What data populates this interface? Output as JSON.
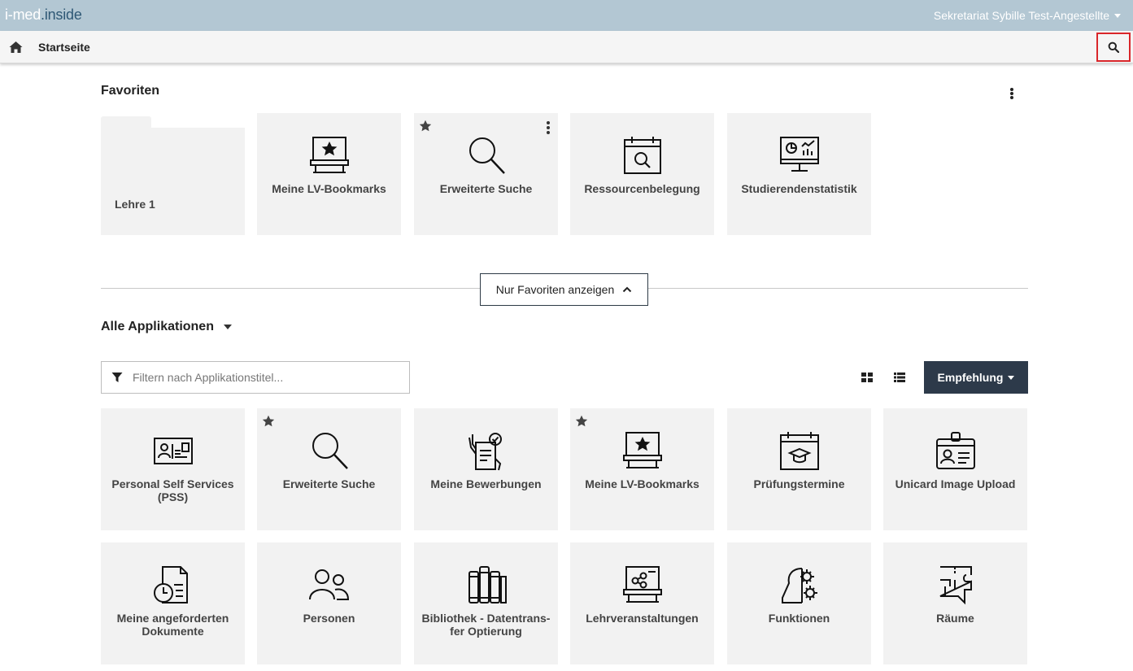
{
  "brand": {
    "part1": "i-med",
    "part2": ".inside"
  },
  "user": {
    "name": "Sekretariat Sybille Test-Angestellte"
  },
  "nav": {
    "title": "Startseite"
  },
  "favorites": {
    "title": "Favoriten",
    "folder": {
      "label": "Lehre 1"
    },
    "tiles": [
      {
        "label": "Meine LV-Bookmarks",
        "icon": "lv-bookmarks-icon"
      },
      {
        "label": "Erweiterte Suche",
        "icon": "magnifier-icon",
        "starred": true
      },
      {
        "label": "Ressourcenbelegung",
        "icon": "calendar-search-icon"
      },
      {
        "label": "Studierendenstatistik",
        "icon": "statistics-monitor-icon"
      }
    ]
  },
  "toggle": {
    "label": "Nur Favoriten anzeigen"
  },
  "apps": {
    "title": "Alle Applikationen",
    "filter_placeholder": "Filtern nach Applikationstitel...",
    "sort_label": "Empfehlung",
    "tiles": [
      {
        "label": "Personal Self Services (PSS)",
        "icon": "id-card-icon"
      },
      {
        "label": "Erweiterte Suche",
        "icon": "magnifier-icon",
        "starred": true
      },
      {
        "label": "Meine Bewerbungen",
        "icon": "application-document-icon"
      },
      {
        "label": "Meine LV-Bookmarks",
        "icon": "lv-bookmarks-icon",
        "starred": true
      },
      {
        "label": "Prüfungstermine",
        "icon": "exam-calendar-icon"
      },
      {
        "label": "Unicard Image Upload",
        "icon": "unicard-badge-icon"
      },
      {
        "label": "Meine angeforderten Dokumente",
        "icon": "document-clock-icon"
      },
      {
        "label": "Personen",
        "icon": "persons-icon"
      },
      {
        "label": "Bibliothek - Datentrans-fer Optierung",
        "icon": "library-books-icon"
      },
      {
        "label": "Lehrveranstaltungen",
        "icon": "lecture-board-icon"
      },
      {
        "label": "Funktionen",
        "icon": "head-gear-icon"
      },
      {
        "label": "Räume",
        "icon": "rooms-icon"
      }
    ]
  },
  "colors": {
    "topbar": "#b3c7d3",
    "brand_dark": "#2f5875",
    "sort_button": "#2d3a4a",
    "highlight": "#d9262a",
    "tile": "#f2f2f2"
  }
}
